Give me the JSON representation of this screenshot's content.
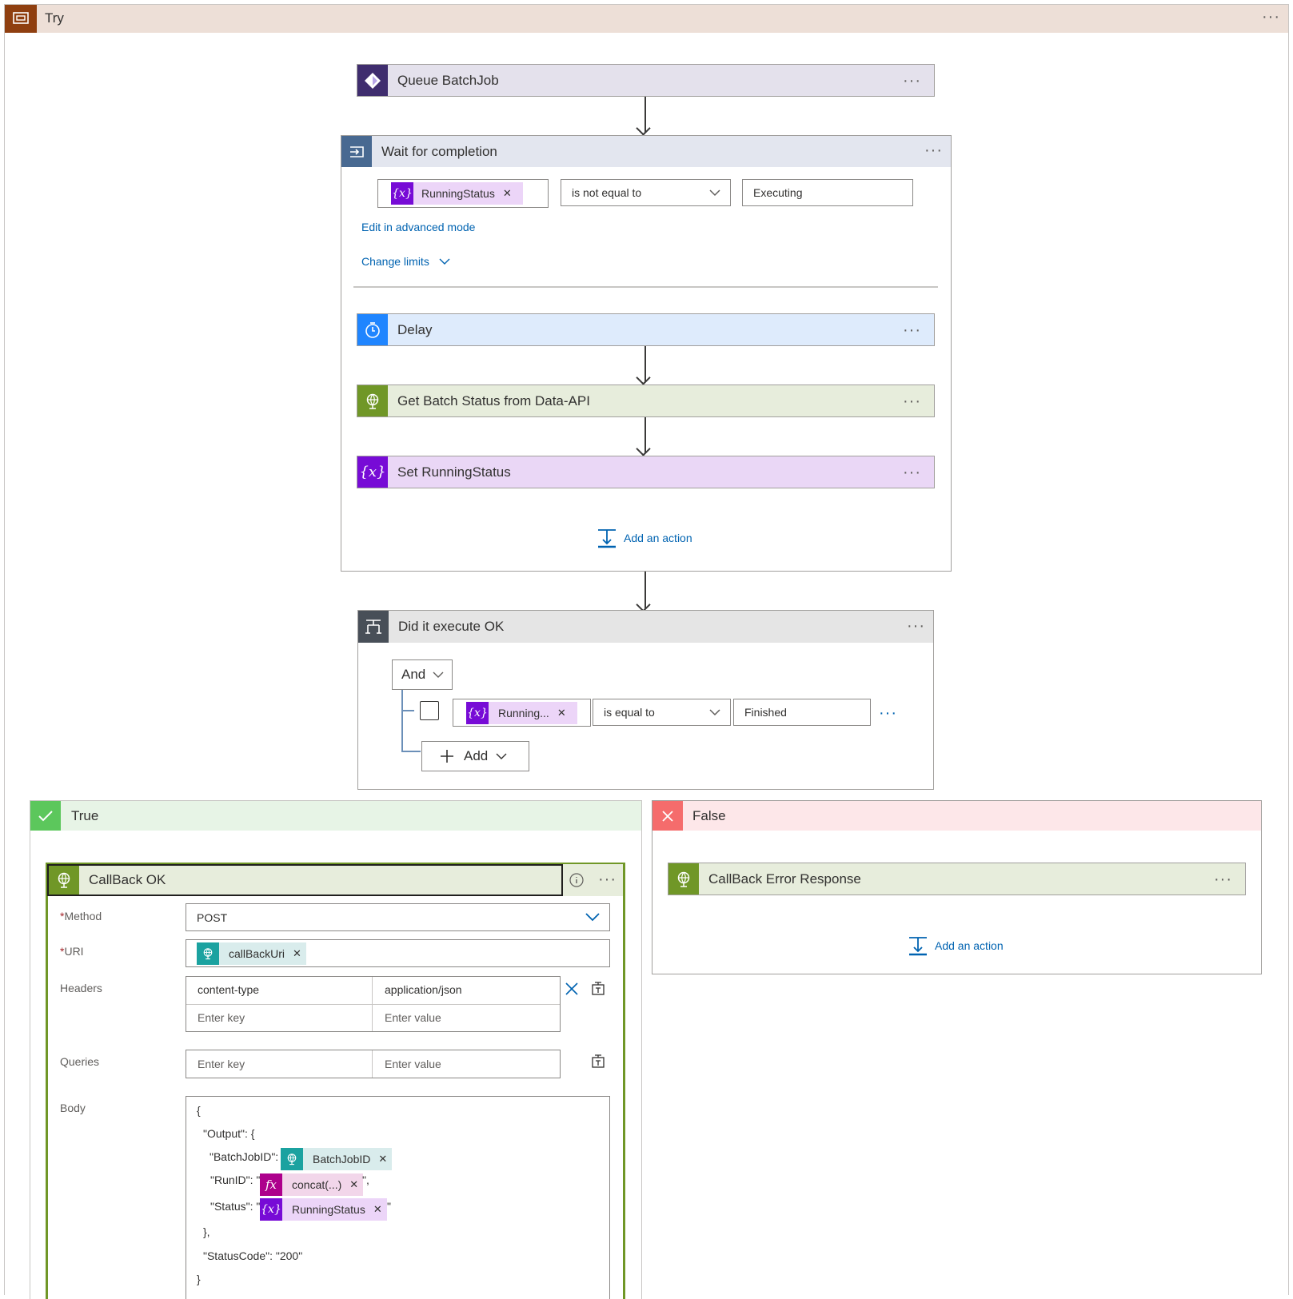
{
  "scope": {
    "title": "Try"
  },
  "queue_batchjob": {
    "title": "Queue BatchJob"
  },
  "wait_loop": {
    "title": "Wait for completion",
    "condition": {
      "token": "RunningStatus",
      "operator": "is not equal to",
      "value": "Executing"
    },
    "advanced_link": "Edit in advanced mode",
    "limits_link": "Change limits",
    "add_action": "Add an action"
  },
  "delay": {
    "title": "Delay"
  },
  "get_status": {
    "title": "Get Batch Status from Data-API"
  },
  "set_status": {
    "title": "Set RunningStatus"
  },
  "condition": {
    "title": "Did it execute OK",
    "group": "And",
    "row": {
      "token": "Running...",
      "operator": "is equal to",
      "value": "Finished"
    },
    "add_label": "Add"
  },
  "true_branch": {
    "title": "True",
    "callback": {
      "title": "CallBack OK",
      "method_label": "Method",
      "method_value": "POST",
      "uri_label": "URI",
      "uri_token": "callBackUri",
      "headers_label": "Headers",
      "header_key": "content-type",
      "header_value": "application/json",
      "key_placeholder": "Enter key",
      "value_placeholder": "Enter value",
      "queries_label": "Queries",
      "body_label": "Body",
      "body": {
        "open_brace": "{",
        "output_open": "\"Output\": {",
        "batch_key": "\"BatchJobID\":",
        "batch_token": "BatchJobID",
        "run_key": "\"RunID\": \"",
        "run_token": "concat(...)",
        "run_after": "\",",
        "status_key": "\"Status\": \"",
        "status_token": "RunningStatus",
        "status_after": "\"",
        "output_close": "},",
        "status_code": "\"StatusCode\": \"200\"",
        "close_brace": "}"
      }
    }
  },
  "false_branch": {
    "title": "False",
    "callback_error": {
      "title": "CallBack Error Response"
    },
    "add_action": "Add an action"
  },
  "colors": {
    "scope_icon": "#8f3f10",
    "scope_header": "#eddfd7",
    "batch_icon": "#3f2d6e",
    "loop_icon": "#486991",
    "delay_icon": "#1f85ff",
    "http_icon": "#709727",
    "variable_icon": "#770bd6",
    "condition_icon": "#484f58",
    "true_icon": "#5cc75c",
    "false_icon": "#f56c6c",
    "link": "#0063b1"
  }
}
